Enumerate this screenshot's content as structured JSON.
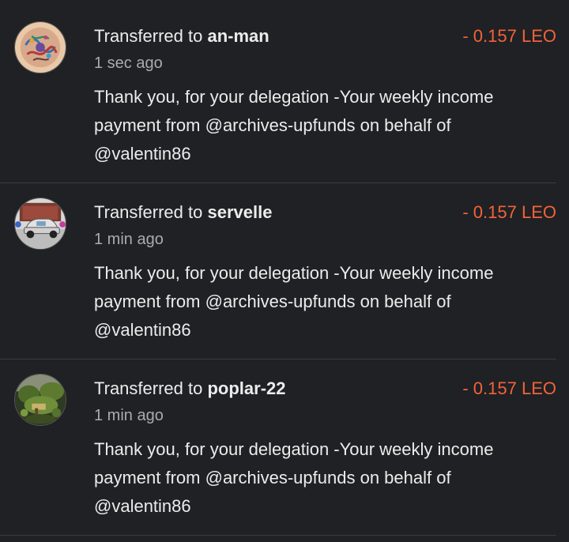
{
  "transactions": [
    {
      "prefix": "Transferred to ",
      "user": "an-man",
      "amount": "- 0.157 LEO",
      "time": "1 sec ago",
      "memo": "Thank you, for your delegation -Your weekly income payment from @archives-upfunds on behalf of @valentin86",
      "avatar_icon": "colorful-pattern-avatar"
    },
    {
      "prefix": "Transferred to ",
      "user": "servelle",
      "amount": "- 0.157 LEO",
      "time": "1 min ago",
      "memo": "Thank you, for your delegation -Your weekly income payment from @archives-upfunds on behalf of @valentin86",
      "avatar_icon": "vintage-car-avatar"
    },
    {
      "prefix": "Transferred to ",
      "user": "poplar-22",
      "amount": "- 0.157 LEO",
      "time": "1 min ago",
      "memo": "Thank you, for your delegation -Your weekly income payment from @archives-upfunds on behalf of @valentin86",
      "avatar_icon": "garden-photo-avatar"
    }
  ],
  "colors": {
    "background": "#1f2124",
    "amount": "#f4623a",
    "secondary_text": "#a9abaf",
    "divider": "#3a3c40"
  }
}
